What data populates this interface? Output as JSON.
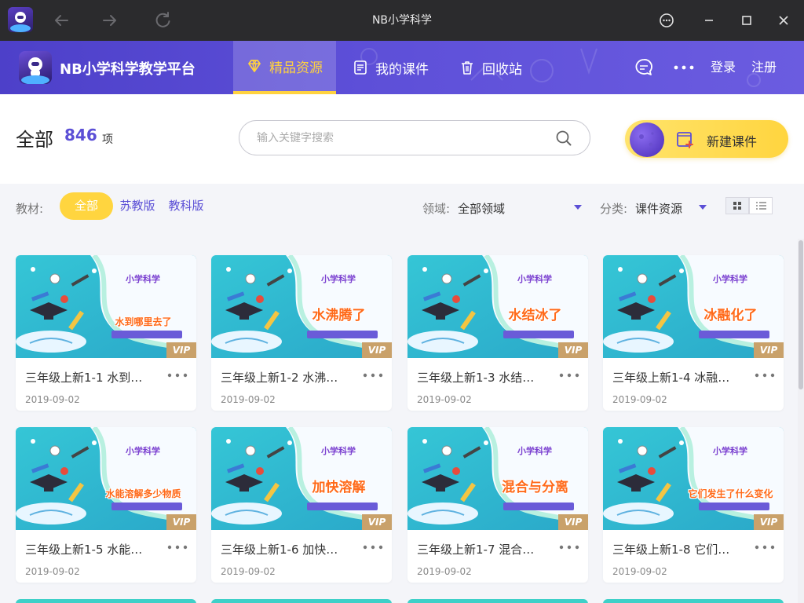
{
  "window": {
    "title": "NB小学科学"
  },
  "header": {
    "brand": "NB小学科学教学平台",
    "tabs": [
      {
        "label": "精品资源",
        "icon": "diamond-icon",
        "active": true
      },
      {
        "label": "我的课件",
        "icon": "document-icon",
        "active": false
      },
      {
        "label": "回收站",
        "icon": "trash-icon",
        "active": false
      }
    ],
    "login": "登录",
    "register": "注册"
  },
  "toolbar": {
    "total_label": "全部",
    "total_count": "846",
    "total_unit": "项",
    "search_placeholder": "输入关键字搜索",
    "new_button": "新建课件"
  },
  "filters": {
    "textbook_label": "教材:",
    "textbook_options": [
      "全部",
      "苏教版",
      "教科版"
    ],
    "textbook_selected": "全部",
    "domain_label": "领域:",
    "domain_value": "全部领域",
    "category_label": "分类:",
    "category_value": "课件资源"
  },
  "cards": [
    {
      "title": "三年级上新1-1 水到…",
      "date": "2019-09-02",
      "thumb_title": "水到哪里去了",
      "badge": "VIP"
    },
    {
      "title": "三年级上新1-2 水沸…",
      "date": "2019-09-02",
      "thumb_title": "水沸腾了",
      "badge": "VIP"
    },
    {
      "title": "三年级上新1-3 水结…",
      "date": "2019-09-02",
      "thumb_title": "水结冰了",
      "badge": "VIP"
    },
    {
      "title": "三年级上新1-4 冰融…",
      "date": "2019-09-02",
      "thumb_title": "冰融化了",
      "badge": "VIP"
    },
    {
      "title": "三年级上新1-5 水能…",
      "date": "2019-09-02",
      "thumb_title": "水能溶解多少物质",
      "badge": "VIP"
    },
    {
      "title": "三年级上新1-6 加快…",
      "date": "2019-09-02",
      "thumb_title": "加快溶解",
      "badge": "VIP"
    },
    {
      "title": "三年级上新1-7 混合…",
      "date": "2019-09-02",
      "thumb_title": "混合与分离",
      "badge": "VIP"
    },
    {
      "title": "三年级上新1-8 它们…",
      "date": "2019-09-02",
      "thumb_title": "它们发生了什么变化",
      "badge": "VIP"
    }
  ],
  "colors": {
    "accent": "#5b4fd6",
    "header": "#5447d0",
    "highlight": "#ffd53f",
    "vip": "#c9a16a"
  }
}
